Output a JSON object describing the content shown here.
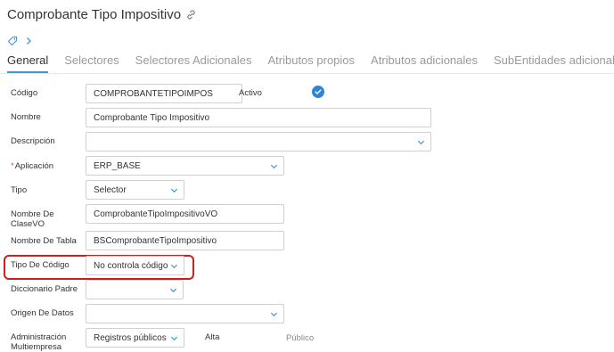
{
  "header": {
    "title": "Comprobante Tipo Impositivo"
  },
  "tabs": [
    {
      "label": "General"
    },
    {
      "label": "Selectores"
    },
    {
      "label": "Selectores Adicionales"
    },
    {
      "label": "Atributos propios"
    },
    {
      "label": "Atributos adicionales"
    },
    {
      "label": "SubEntidades adicionales"
    }
  ],
  "form": {
    "codigo": {
      "label": "Código",
      "value": "COMPROBANTETIPOIMPOS"
    },
    "activo": {
      "label": "Activo",
      "checked": true
    },
    "nombre": {
      "label": "Nombre",
      "value": "Comprobante Tipo Impositivo"
    },
    "descripcion": {
      "label": "Descripción",
      "value": ""
    },
    "aplicacion": {
      "label": "Aplicación",
      "value": "ERP_BASE",
      "required_marker": "*"
    },
    "tipo": {
      "label": "Tipo",
      "value": "Selector"
    },
    "nombre_clase_vo": {
      "label_line1": "Nombre De",
      "label_line2": "ClaseVO",
      "value": "ComprobanteTipoImpositivoVO"
    },
    "nombre_tabla": {
      "label": "Nombre De Tabla",
      "value": "BSComprobanteTipoImpositivo"
    },
    "tipo_codigo": {
      "label": "Tipo De Código",
      "value": "No controla código"
    },
    "diccionario_padre": {
      "label": "Diccionario Padre",
      "value": ""
    },
    "origen_datos": {
      "label": "Origen De Datos",
      "value": ""
    },
    "admin_multiempresa": {
      "label_line1": "Administración",
      "label_line2": "Multiempresa",
      "value": "Registros públicos"
    },
    "alta": {
      "label": "Alta",
      "value": "Público"
    }
  },
  "colors": {
    "accent": "#3b9ad9",
    "highlight": "#cc1f1f",
    "check": "#2f86d6"
  }
}
